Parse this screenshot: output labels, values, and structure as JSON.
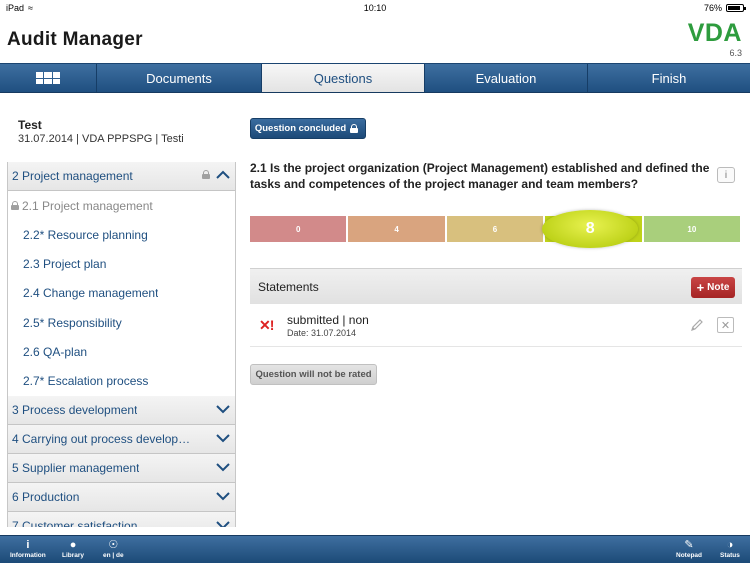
{
  "status_bar": {
    "carrier": "iPad",
    "time": "10:10",
    "battery": "76%",
    "battery_level": 0.76
  },
  "header": {
    "title": "Audit Manager",
    "logo": "VDA",
    "version": "6.3"
  },
  "tabs": [
    {
      "label": "",
      "icon": "grid-icon"
    },
    {
      "label": "Documents"
    },
    {
      "label": "Questions",
      "active": true
    },
    {
      "label": "Evaluation"
    },
    {
      "label": "Finish"
    }
  ],
  "project": {
    "name": "Test",
    "meta": "31.07.2014 | VDA PPPSPG | Testi"
  },
  "nav": {
    "items": [
      {
        "label": "2 Project management",
        "type": "section",
        "expanded": true,
        "locked": true
      },
      {
        "label": "2.1 Project management",
        "type": "sub",
        "current": true,
        "locked": true
      },
      {
        "label": "2.2* Resource planning",
        "type": "sub"
      },
      {
        "label": "2.3 Project plan",
        "type": "sub"
      },
      {
        "label": "2.4 Change management",
        "type": "sub"
      },
      {
        "label": "2.5* Responsibility",
        "type": "sub"
      },
      {
        "label": "2.6 QA-plan",
        "type": "sub"
      },
      {
        "label": "2.7* Escalation process",
        "type": "sub"
      },
      {
        "label": "3 Process development",
        "type": "section"
      },
      {
        "label": "4 Carrying out process develop…",
        "type": "section"
      },
      {
        "label": "5 Supplier management",
        "type": "section"
      },
      {
        "label": "6 Production",
        "type": "section"
      },
      {
        "label": "7 Customer satisfaction",
        "type": "section"
      }
    ]
  },
  "question": {
    "concluded_label": "Question concluded",
    "text": "2.1 Is the project organization (Project Management) established and defined the tasks and competences of the project manager and team members?",
    "rating": {
      "options": [
        "0",
        "4",
        "6",
        "8",
        "10"
      ],
      "selected": "8",
      "colors": [
        "#d28a8a",
        "#d9a47f",
        "#d8c07e",
        "#bfd31a",
        "#a9cf7c"
      ]
    }
  },
  "statements": {
    "title": "Statements",
    "note_label": "Note",
    "items": [
      {
        "flag": "✕!",
        "title": "submitted | non",
        "date": "Date: 31.07.2014"
      }
    ]
  },
  "not_rated_label": "Question will not be rated",
  "toolbar": {
    "left": [
      {
        "label": "Information",
        "icon": "info-icon"
      },
      {
        "label": "Library",
        "icon": "library-icon"
      },
      {
        "label": "en | de",
        "icon": "globe-icon"
      }
    ],
    "right": [
      {
        "label": "Notepad",
        "icon": "pencil-icon"
      },
      {
        "label": "Status",
        "icon": "status-icon"
      }
    ]
  }
}
